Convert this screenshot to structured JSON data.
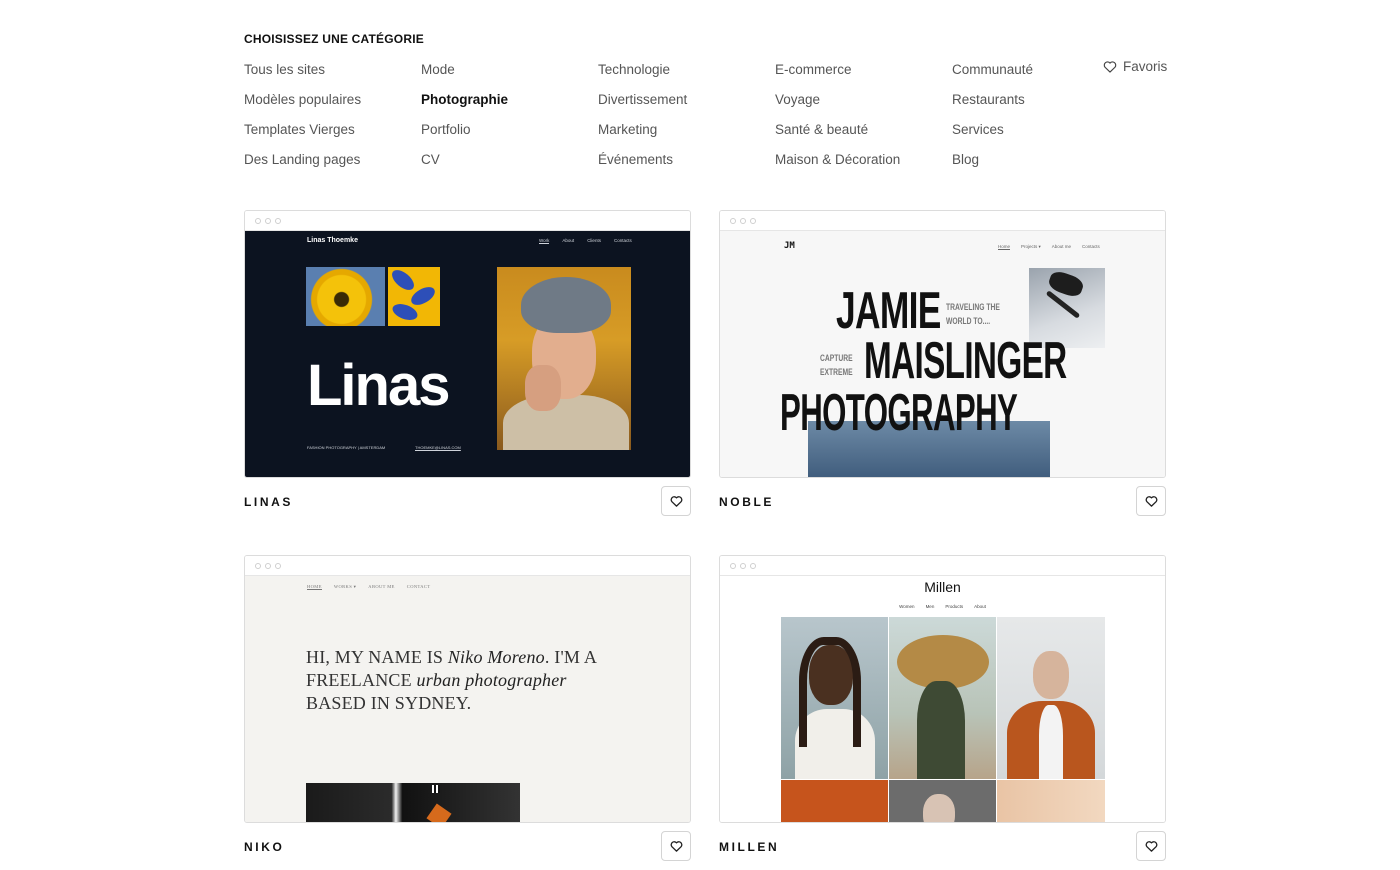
{
  "categories": {
    "heading": "CHOISISSEZ UNE CATÉGORIE",
    "columns": [
      [
        "Tous les sites",
        "Modèles populaires",
        "Templates Vierges",
        "Des Landing pages"
      ],
      [
        "Mode",
        "Photographie",
        "Portfolio",
        "CV"
      ],
      [
        "Technologie",
        "Divertissement",
        "Marketing",
        "Événements"
      ],
      [
        "E-commerce",
        "Voyage",
        "Santé & beauté",
        "Maison & Décoration"
      ],
      [
        "Communauté",
        "Restaurants",
        "Services",
        "Blog"
      ]
    ],
    "active": "Photographie",
    "favorites_label": "Favoris"
  },
  "templates": [
    {
      "name": "LINAS",
      "preview": {
        "brand": "Linas Thoemke",
        "nav": [
          "Work",
          "About",
          "Clients",
          "Contacts"
        ],
        "headline": "Linas",
        "footer_left": "FASHION PHOTOGRAPHY | AMSTERDAM",
        "footer_right": "THOEMKE@LINAS.COM"
      }
    },
    {
      "name": "NOBLE",
      "preview": {
        "brand": "JM",
        "nav": [
          "Home",
          "Projects ▾",
          "About me",
          "Contacts"
        ],
        "line1": "JAMIE",
        "line2": "MAISLINGER",
        "line3": "PHOTOGRAPHY",
        "tag1": "TRAVELING THE",
        "tag1b": "WORLD TO....",
        "tag2": "CAPTURE",
        "tag2b": "EXTREME"
      }
    },
    {
      "name": "NIKO",
      "preview": {
        "nav": [
          "HOME",
          "WORKS ▾",
          "ABOUT ME",
          "CONTACT"
        ],
        "t1": "HI, MY NAME IS ",
        "t1_em": "Niko Moreno",
        "t1_end": ". I'M A",
        "t2": "FREELANCE ",
        "t2_em": "urban photographer",
        "t3": "BASED IN SYDNEY."
      }
    },
    {
      "name": "MILLEN",
      "preview": {
        "brand": "Millen",
        "nav": [
          "Women",
          "Men",
          "Products",
          "About"
        ]
      }
    }
  ],
  "colors": {
    "active_category": "#111111",
    "category": "#555555",
    "border": "#dcdcdc"
  },
  "icons": {
    "favorites": "heart-outline-icon",
    "card_favorite": "heart-outline-icon"
  }
}
